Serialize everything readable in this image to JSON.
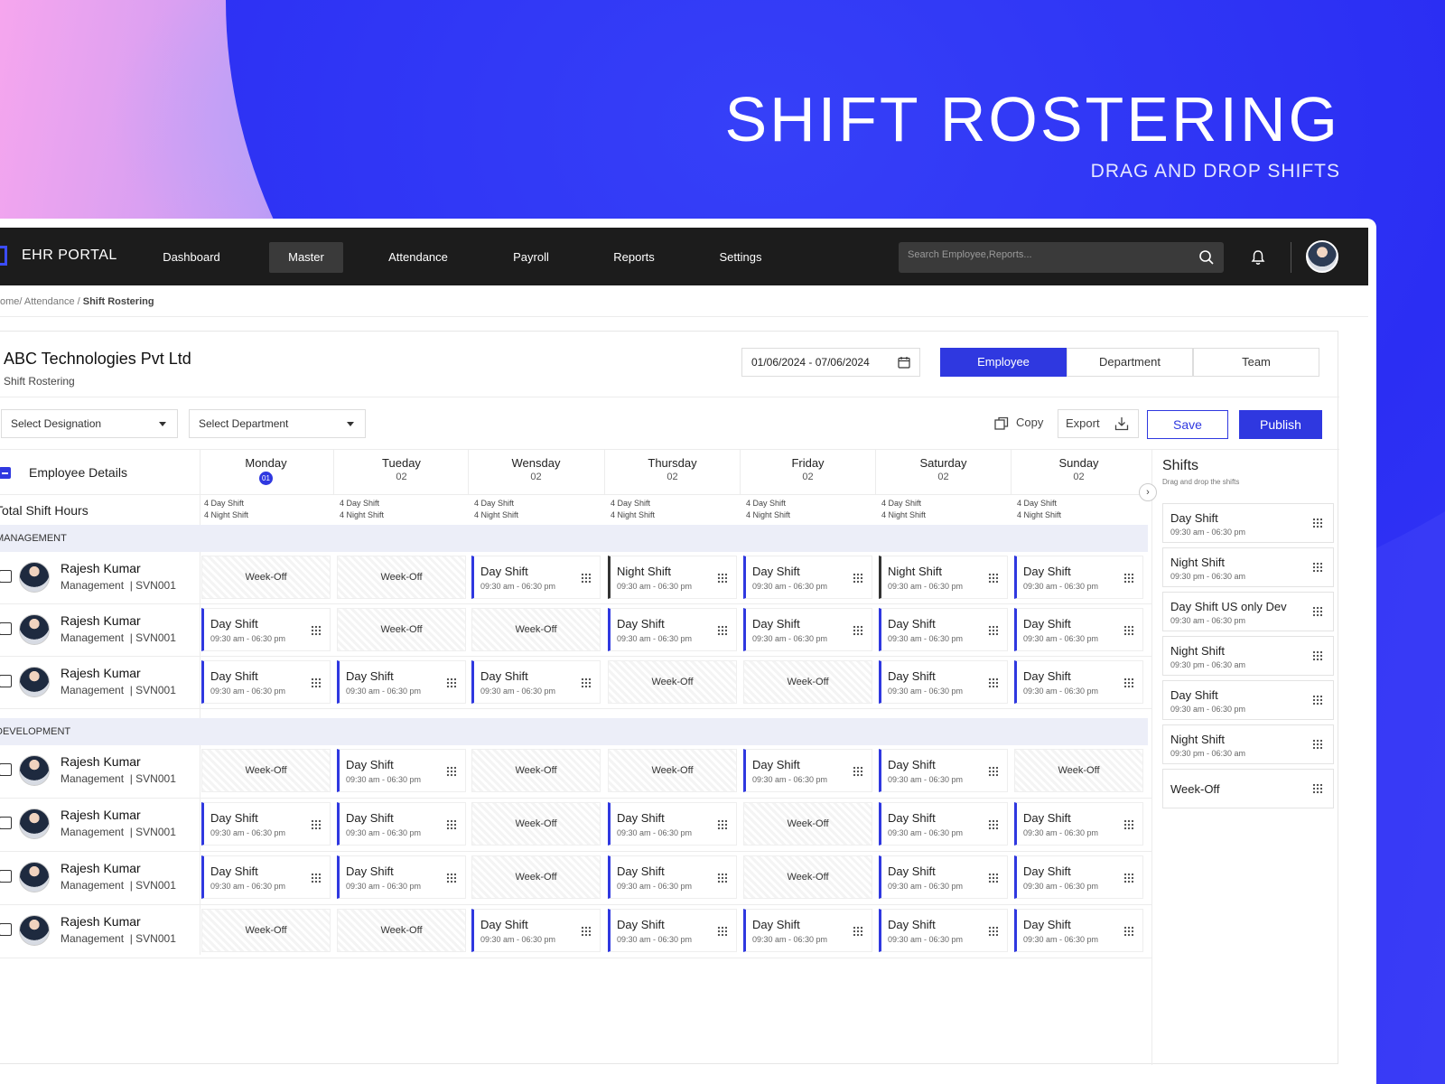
{
  "hero": {
    "title": "SHIFT ROSTERING",
    "subtitle": "DRAG AND DROP SHIFTS"
  },
  "colors": {
    "accent": "#2f38e0",
    "nav_bg": "#1c1c1c",
    "group_bg": "#eceef8"
  },
  "topbar": {
    "brand": "EHR PORTAL",
    "nav": [
      "Dashboard",
      "Master",
      "Attendance",
      "Payroll",
      "Reports",
      "Settings"
    ],
    "active_nav": "Master",
    "search_placeholder": "Search Employee,Reports...",
    "icons": [
      "search-icon",
      "bell-icon",
      "avatar"
    ]
  },
  "breadcrumb": {
    "prefix": "ome/ Attendance / ",
    "current": "Shift Rostering"
  },
  "header": {
    "company": "ABC Technologies Pvt Ltd",
    "subtitle": "Shift Rostering",
    "date_range": "01/06/2024 - 07/06/2024",
    "view_tabs": [
      "Employee",
      "Department",
      "Team"
    ],
    "active_tab": "Employee"
  },
  "filters": {
    "designation": "Select Designation",
    "department": "Select Department"
  },
  "actions": {
    "copy": "Copy",
    "export": "Export",
    "save": "Save",
    "publish": "Publish"
  },
  "table": {
    "employee_header": "Employee Details",
    "total_label": "Total Shift Hours",
    "days": [
      {
        "name": "Monday",
        "num": "01",
        "today": true,
        "day_count": "4 Day Shift",
        "night_count": "4 Night Shift"
      },
      {
        "name": "Tueday",
        "num": "02",
        "today": false,
        "day_count": "4 Day Shift",
        "night_count": "4 Night Shift"
      },
      {
        "name": "Wensday",
        "num": "02",
        "today": false,
        "day_count": "4 Day Shift",
        "night_count": "4 Night Shift"
      },
      {
        "name": "Thursday",
        "num": "02",
        "today": false,
        "day_count": "4 Day Shift",
        "night_count": "4 Night Shift"
      },
      {
        "name": "Friday",
        "num": "02",
        "today": false,
        "day_count": "4 Day Shift",
        "night_count": "4 Night Shift"
      },
      {
        "name": "Saturday",
        "num": "02",
        "today": false,
        "day_count": "4 Day Shift",
        "night_count": "4 Night Shift"
      },
      {
        "name": "Sunday",
        "num": "02",
        "today": false,
        "day_count": "4 Day Shift",
        "night_count": "4 Night Shift"
      }
    ],
    "shift_time": {
      "day": "09:30 am - 06:30 pm",
      "night": "09:30 am - 06:30 pm"
    },
    "week_off_label": "Week-Off",
    "groups": [
      {
        "name": "MANAGEMENT",
        "rows": [
          {
            "name": "Rajesh Kumar",
            "dept": "Management",
            "code": "SVN001",
            "cells": [
              "W",
              "W",
              "D",
              "N",
              "D",
              "N",
              "D"
            ]
          },
          {
            "name": "Rajesh Kumar",
            "dept": "Management",
            "code": "SVN001",
            "cells": [
              "D",
              "W",
              "W",
              "D",
              "D",
              "D",
              "D"
            ]
          },
          {
            "name": "Rajesh Kumar",
            "dept": "Management",
            "code": "SVN001",
            "cells": [
              "D",
              "D",
              "D",
              "W",
              "W",
              "D",
              "D"
            ]
          }
        ]
      },
      {
        "name": "DEVELOPMENT",
        "rows": [
          {
            "name": "Rajesh Kumar",
            "dept": "Management",
            "code": "SVN001",
            "cells": [
              "W",
              "D",
              "W",
              "W",
              "D",
              "D",
              "W"
            ]
          },
          {
            "name": "Rajesh Kumar",
            "dept": "Management",
            "code": "SVN001",
            "cells": [
              "D",
              "D",
              "W",
              "D",
              "W",
              "D",
              "D"
            ]
          },
          {
            "name": "Rajesh Kumar",
            "dept": "Management",
            "code": "SVN001",
            "cells": [
              "D",
              "D",
              "W",
              "D",
              "W",
              "D",
              "D"
            ]
          },
          {
            "name": "Rajesh Kumar",
            "dept": "Management",
            "code": "SVN001",
            "cells": [
              "W",
              "W",
              "D",
              "D",
              "D",
              "D",
              "D"
            ]
          }
        ]
      }
    ]
  },
  "shifts_panel": {
    "title": "Shifts",
    "subtitle": "Drag and drop the shifts",
    "items": [
      {
        "label": "Day Shift",
        "time": "09:30 am - 06:30 pm"
      },
      {
        "label": "Night Shift",
        "time": "09:30 pm - 06:30 am"
      },
      {
        "label": "Day Shift US only Dev",
        "time": "09:30 am - 06:30 pm"
      },
      {
        "label": "Night Shift",
        "time": "09:30 pm - 06:30 am"
      },
      {
        "label": "Day Shift",
        "time": "09:30 am - 06:30 pm"
      },
      {
        "label": "Night Shift",
        "time": "09:30 pm - 06:30 am"
      },
      {
        "label": "Week-Off",
        "time": ""
      }
    ]
  }
}
